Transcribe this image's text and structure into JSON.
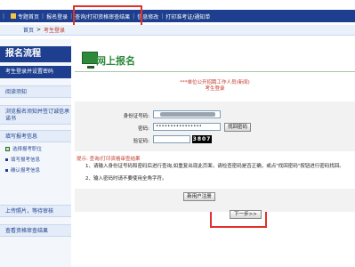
{
  "topnav": {
    "items": [
      "专题首页",
      "报名登录",
      "查询/打印资格审查结果",
      "信息修改",
      "打印准考证/通知单"
    ]
  },
  "breadcrumb": {
    "home": "首页",
    "current": "考生登录"
  },
  "sidebar": {
    "title": "报名流程",
    "active": "考生登录并设置密码",
    "groups": [
      {
        "label": "阅读须知"
      },
      {
        "label": "浏览报名须知并签订诚信承诺书"
      },
      {
        "label": "填写报考信息"
      }
    ],
    "subs": [
      "选择报考职位",
      "填写报考信息",
      "确认报考信息"
    ],
    "groups2": [
      {
        "label": "上传照片，等待审核"
      },
      {
        "label": "查看资格审查结果"
      }
    ]
  },
  "main": {
    "title": "网上报名",
    "notice_line1": "***单位公开招聘工作人员(新闻)",
    "notice_line2": "考生登录"
  },
  "form": {
    "id_label": "身份证号码:",
    "id_value": "",
    "password_label": "密码:",
    "password_value": "••••••••••••••••",
    "find_password": "找回密码",
    "captcha_label": "验证码:",
    "captcha_value": "3807",
    "captcha_input": ""
  },
  "tips": {
    "title": "提示: 查询/打印资格审查结果",
    "line1": "1、请输入身份证号码和密码后进行查询,如重复出现此页面，请检查密码是否正确，或点\"找回密码\"按钮进行密码找回。",
    "line2": "2、输入密码时请不要使用全角字符。"
  },
  "actions": {
    "register": "新用户注册",
    "next": "下一步>>"
  },
  "colors": {
    "nav": "#1e3f8f",
    "accent_green": "#2e8a3a",
    "highlight": "#e0322a"
  }
}
